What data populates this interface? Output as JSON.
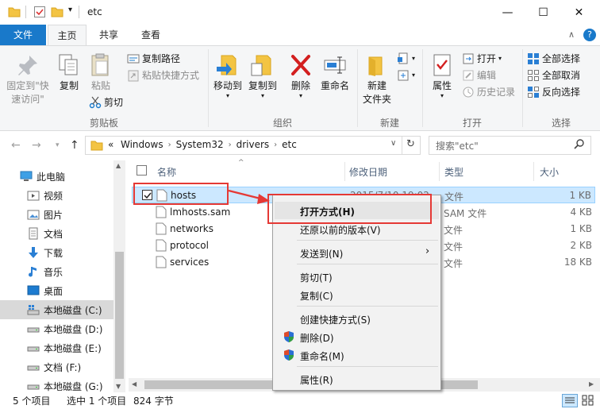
{
  "window": {
    "title": "etc",
    "controls": {
      "minimize": "—",
      "maximize": "☐",
      "close": "✕"
    }
  },
  "ribbon_tabs": [
    "文件",
    "主页",
    "共享",
    "查看"
  ],
  "ribbon": {
    "pin_label": "固定到\"快速访问\"",
    "copy": "复制",
    "paste": "粘贴",
    "copy_path": "复制路径",
    "paste_shortcut": "粘贴快捷方式",
    "cut": "剪切",
    "clipboard_group": "剪贴板",
    "move_to": "移动到",
    "copy_to": "复制到",
    "delete": "删除",
    "rename": "重命名",
    "organize_group": "组织",
    "new_folder_l1": "新建",
    "new_folder_l2": "文件夹",
    "new_group": "新建",
    "properties": "属性",
    "open": "打开",
    "edit": "编辑",
    "history": "历史记录",
    "open_group": "打开",
    "select_all": "全部选择",
    "select_none": "全部取消",
    "invert_selection": "反向选择",
    "select_group": "选择"
  },
  "address": {
    "prefix": "«",
    "crumbs": [
      "Windows",
      "System32",
      "drivers",
      "etc"
    ],
    "search_placeholder": "搜索\"etc\""
  },
  "nav": [
    "此电脑",
    "视频",
    "图片",
    "文档",
    "下载",
    "音乐",
    "桌面",
    "本地磁盘 (C:)",
    "本地磁盘 (D:)",
    "本地磁盘 (E:)",
    "文档 (F:)",
    "本地磁盘 (G:)"
  ],
  "columns": {
    "name": "名称",
    "modified": "修改日期",
    "type": "类型",
    "size": "大小"
  },
  "files": [
    {
      "name": "hosts",
      "modified": "2015/7/10 19:02",
      "type": "文件",
      "size": "1 KB"
    },
    {
      "name": "lmhosts.sam",
      "modified": "",
      "type": "SAM 文件",
      "size": "4 KB"
    },
    {
      "name": "networks",
      "modified": "",
      "type": "文件",
      "size": "1 KB"
    },
    {
      "name": "protocol",
      "modified": "",
      "type": "文件",
      "size": "2 KB"
    },
    {
      "name": "services",
      "modified": "",
      "type": "文件",
      "size": "18 KB"
    }
  ],
  "context_menu": {
    "open_with": "打开方式(H)",
    "restore": "还原以前的版本(V)",
    "send_to": "发送到(N)",
    "cut": "剪切(T)",
    "copy": "复制(C)",
    "create_shortcut": "创建快捷方式(S)",
    "delete": "删除(D)",
    "rename": "重命名(M)",
    "properties": "属性(R)"
  },
  "status": {
    "count": "5 个项目",
    "selected": "选中 1 个项目",
    "size": "824 字节"
  },
  "colors": {
    "file_tab": "#1979ca",
    "selection": "#cce8ff",
    "annotation": "#e53935"
  }
}
